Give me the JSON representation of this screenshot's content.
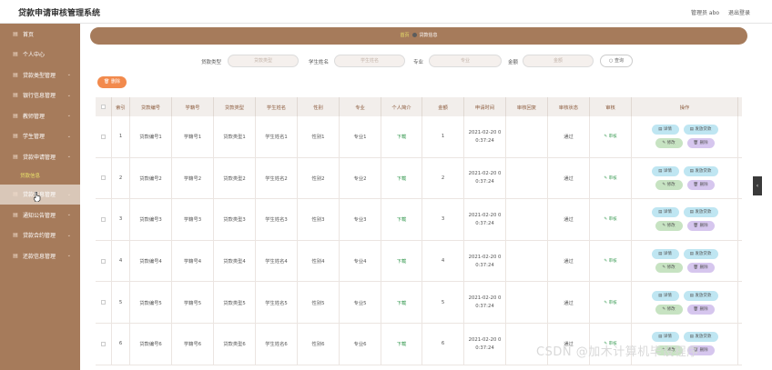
{
  "header": {
    "title": "贷款申请审核管理系统",
    "user_label": "管理员 abo",
    "logout": "退出登录"
  },
  "sidebar": {
    "items": [
      {
        "label": "首页",
        "icon": "home-icon"
      },
      {
        "label": "个人中心",
        "icon": "user-icon"
      },
      {
        "label": "贷款类型管理",
        "icon": "tag-icon"
      },
      {
        "label": "银行信息管理",
        "icon": "bank-icon"
      },
      {
        "label": "教师管理",
        "icon": "teacher-icon"
      },
      {
        "label": "学生管理",
        "icon": "student-icon"
      },
      {
        "label": "贷款申请管理",
        "icon": "apply-icon"
      },
      {
        "label": "贷款信息",
        "sub": true,
        "active": true
      },
      {
        "label": "贷款信息管理",
        "icon": "info-icon",
        "hover": true
      },
      {
        "label": "通知公告管理",
        "icon": "notice-icon"
      },
      {
        "label": "贷款合约管理",
        "icon": "contract-icon"
      },
      {
        "label": "还款信息管理",
        "icon": "repay-icon"
      }
    ]
  },
  "breadcrumb": {
    "home": "首页",
    "current": "贷款信息"
  },
  "search": {
    "type_label": "贷款类型",
    "type_placeholder": "贷款类型",
    "name_label": "学生姓名",
    "name_placeholder": "学生姓名",
    "major_label": "专业",
    "major_placeholder": "专业",
    "amount_label": "金额",
    "amount_placeholder": "金额",
    "button": "查询"
  },
  "delete_button": "删除",
  "table": {
    "headers": [
      "索引",
      "贷款编号",
      "学籍号",
      "贷款类型",
      "学生姓名",
      "性别",
      "专业",
      "个人简介",
      "金额",
      "申请时间",
      "审核回复",
      "审核状态",
      "审核",
      "操作"
    ],
    "rows": [
      {
        "idx": "1",
        "loan_no": "贷款编号1",
        "student_no": "学籍号1",
        "loan_type": "贷款类型1",
        "name": "学生姓名1",
        "gender": "性别1",
        "major": "专业1",
        "intro": "下载",
        "amount": "1",
        "time1": "2021-02-20 0",
        "time2": "0:37:24",
        "reply": "",
        "status": "通过",
        "audit": "审核"
      },
      {
        "idx": "2",
        "loan_no": "贷款编号2",
        "student_no": "学籍号2",
        "loan_type": "贷款类型2",
        "name": "学生姓名2",
        "gender": "性别2",
        "major": "专业2",
        "intro": "下载",
        "amount": "2",
        "time1": "2021-02-20 0",
        "time2": "0:37:24",
        "reply": "",
        "status": "通过",
        "audit": "审核"
      },
      {
        "idx": "3",
        "loan_no": "贷款编号3",
        "student_no": "学籍号3",
        "loan_type": "贷款类型3",
        "name": "学生姓名3",
        "gender": "性别3",
        "major": "专业3",
        "intro": "下载",
        "amount": "3",
        "time1": "2021-02-20 0",
        "time2": "0:37:24",
        "reply": "",
        "status": "通过",
        "audit": "审核"
      },
      {
        "idx": "4",
        "loan_no": "贷款编号4",
        "student_no": "学籍号4",
        "loan_type": "贷款类型4",
        "name": "学生姓名4",
        "gender": "性别4",
        "major": "专业4",
        "intro": "下载",
        "amount": "4",
        "time1": "2021-02-20 0",
        "time2": "0:37:24",
        "reply": "",
        "status": "通过",
        "audit": "审核"
      },
      {
        "idx": "5",
        "loan_no": "贷款编号5",
        "student_no": "学籍号5",
        "loan_type": "贷款类型5",
        "name": "学生姓名5",
        "gender": "性别5",
        "major": "专业5",
        "intro": "下载",
        "amount": "5",
        "time1": "2021-02-20 0",
        "time2": "0:37:24",
        "reply": "",
        "status": "通过",
        "audit": "审核"
      },
      {
        "idx": "6",
        "loan_no": "贷款编号6",
        "student_no": "学籍号6",
        "loan_type": "贷款类型6",
        "name": "学生姓名6",
        "gender": "性别6",
        "major": "专业6",
        "intro": "下载",
        "amount": "6",
        "time1": "2021-02-20 0",
        "time2": "0:37:24",
        "reply": "",
        "status": "通过",
        "audit": "审核"
      }
    ],
    "ops": {
      "detail": "详情",
      "loan": "发放贷款",
      "edit": "修改",
      "delete": "删除"
    }
  },
  "watermark": "CSDN @加木计算机毕设程序"
}
